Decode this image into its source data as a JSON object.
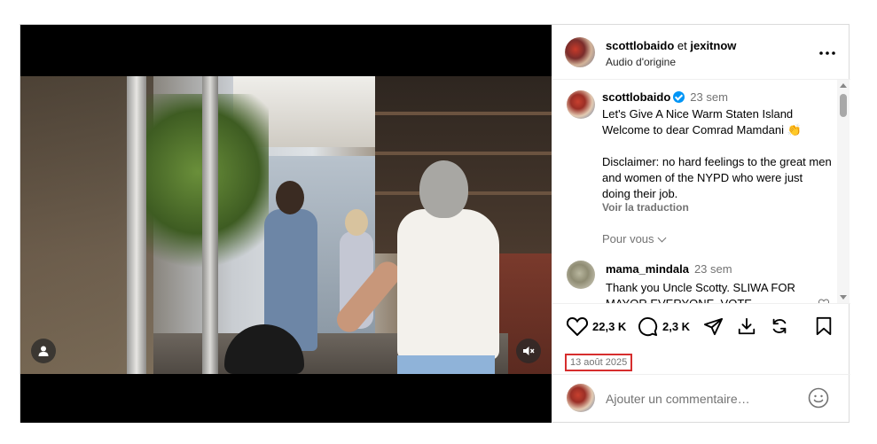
{
  "post": {
    "header": {
      "author": "scottlobaido",
      "connector": "et",
      "collaborator": "jexitnow",
      "audio": "Audio d'origine",
      "more_icon": "more-horizontal-icon"
    },
    "caption": {
      "username": "scottlobaido",
      "verified": true,
      "time": "23 sem",
      "text": "Let's Give A Nice Warm Staten Island Welcome to dear Comrad Mamdani 👏\n\nDisclaimer:  no hard feelings to the great men and women of the NYPD who were just doing their job.",
      "translate_label": "Voir la traduction",
      "more_posts_label": "Pour vous"
    },
    "comment": {
      "username": "mama_mindala",
      "time": "23 sem",
      "text": "Thank you Uncle Scotty. SLIWA FOR MAYOR EVERYONE. VOTE"
    },
    "actions": {
      "likes": "22,3 K",
      "comments": "2,3 K",
      "date": "13 août 2025"
    },
    "comment_input": {
      "placeholder": "Ajouter un commentaire…"
    },
    "colors": {
      "verified": "#0095f6",
      "highlight_box": "#d62d2d",
      "secondary_text": "#737373"
    }
  }
}
